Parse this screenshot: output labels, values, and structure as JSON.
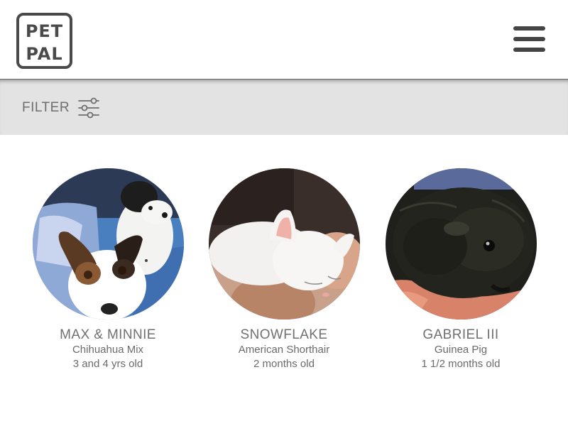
{
  "app": {
    "logo_text_top": "PET",
    "logo_text_bottom": "PAL"
  },
  "header": {
    "menu_icon": "hamburger-menu-icon"
  },
  "filter": {
    "label": "FILTER",
    "icon": "sliders-icon"
  },
  "pets": [
    {
      "name": "MAX & MINNIE",
      "breed": "Chihuahua Mix",
      "age": "3 and 4 yrs old",
      "photo": "dogs-photo"
    },
    {
      "name": "SNOWFLAKE",
      "breed": "American Shorthair",
      "age": "2 months old",
      "photo": "kitten-photo"
    },
    {
      "name": "GABRIEL III",
      "breed": "Guinea Pig",
      "age": "1 1/2 months old",
      "photo": "guinea-pig-photo"
    }
  ],
  "colors": {
    "header_bg": "#ffffff",
    "filter_bar_bg": "#e3e3e3",
    "text": "#707070",
    "logo": "#4a4a4a"
  }
}
